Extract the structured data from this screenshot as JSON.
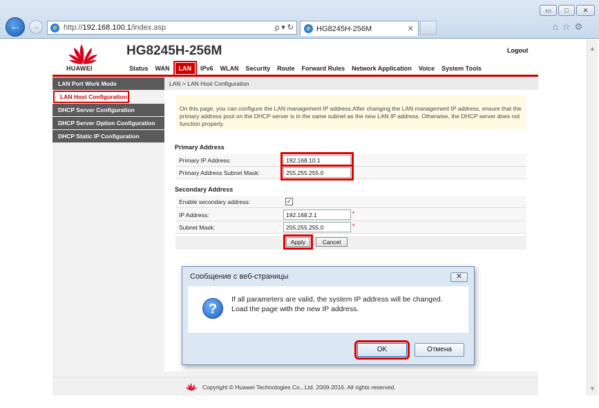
{
  "browser": {
    "window_buttons": {
      "minimize": "▭",
      "maximize": "□",
      "close": "✕"
    },
    "back_arrow": "←",
    "forward_arrow": "→",
    "url_prefix": "http://",
    "url_host": "192.168.100.1",
    "url_path": "/index.asp",
    "address_tools": "ρ ▾ ↻",
    "tab_title": "HG8245H-256M",
    "tab_close": "✕",
    "fav_icons": "⌂☆⚙"
  },
  "header": {
    "brand": "HUAWEI",
    "model": "HG8245H-256M",
    "logout": "Logout",
    "nav": [
      "Status",
      "WAN",
      "LAN",
      "IPv6",
      "WLAN",
      "Security",
      "Route",
      "Forward Rules",
      "Network Application",
      "Voice",
      "System Tools"
    ],
    "active_nav": "LAN"
  },
  "sidebar": {
    "items": [
      "LAN Port Work Mode",
      "LAN Host Configuration",
      "DHCP Server Configuration",
      "DHCP Server Option Configuration",
      "DHCP Static IP Configuration"
    ]
  },
  "content": {
    "breadcrumb": "LAN > LAN Host Configuration",
    "notice": "On this page, you can configure the LAN management IP address.After changing the LAN management IP address, ensure that the primary address pool on the DHCP server is in the same subnet as the new LAN IP address. Otherwise, the DHCP server does not function properly.",
    "primary": {
      "title": "Primary Address",
      "ip_label": "Primary IP Address:",
      "ip_value": "192.168.10.1",
      "mask_label": "Primary Address Subnet Mask:",
      "mask_value": "255.255.255.0"
    },
    "secondary": {
      "title": "Secondary Address",
      "enable_label": "Enable secondary address:",
      "enable_check": "✓",
      "ip_label": "IP Address:",
      "ip_value": "192.168.2.1",
      "mask_label": "Subnet Mask:",
      "mask_value": "255.255.255.0",
      "required_mark": "*"
    },
    "apply_label": "Apply",
    "cancel_label": "Cancel"
  },
  "footer": {
    "copyright": "Copyright © Huawei Technologies Co., Ltd. 2009-2016. All rights reserved."
  },
  "dialog": {
    "title": "Сообщение с веб-страницы",
    "close_glyph": "✕",
    "icon_glyph": "?",
    "message": "If all parameters are valid, the system IP address will be changed. Load the page with the new IP address.",
    "ok_label": "OK",
    "cancel_label": "Отмена"
  },
  "colors": {
    "brand_red": "#c00000",
    "highlight_red": "#e00000",
    "sidebar_gray": "#5a5a5a",
    "notice_bg": "#fefbe2"
  }
}
